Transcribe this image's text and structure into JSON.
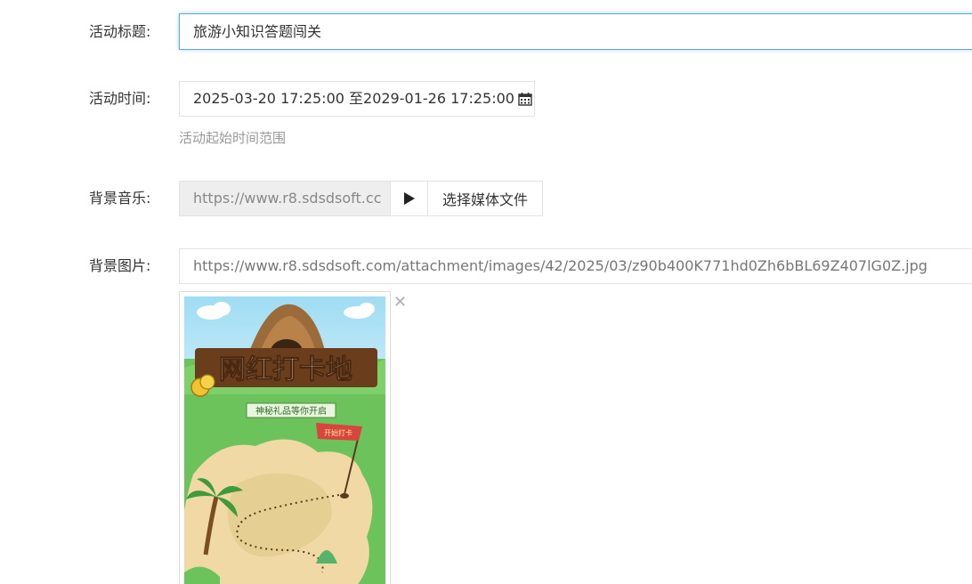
{
  "form": {
    "title": {
      "label": "活动标题:",
      "value": "旅游小知识答题闯关"
    },
    "time": {
      "label": "活动时间:",
      "value": "2025-03-20 17:25:00 至2029-01-26 17:25:00",
      "help": "活动起始时间范围",
      "icon": "calendar-icon"
    },
    "music": {
      "label": "背景音乐:",
      "value": "https://www.r8.sdsdsoft.cc",
      "play_icon": "play-icon",
      "choose_label": "选择媒体文件"
    },
    "image": {
      "label": "背景图片:",
      "value": "https://www.r8.sdsdsoft.com/attachment/images/42/2025/03/z90b400K771hd0Zh6bBL69Z407lG0Z.jpg",
      "preview": {
        "title": "网红打卡地",
        "subtitle": "神秘礼品等你开启",
        "flag_text": "开始打卡"
      },
      "remove_icon": "close-icon"
    }
  },
  "colors": {
    "focus_border": "#5aa9e6",
    "muted_bg": "#eeeeee",
    "help_text": "#999999"
  }
}
